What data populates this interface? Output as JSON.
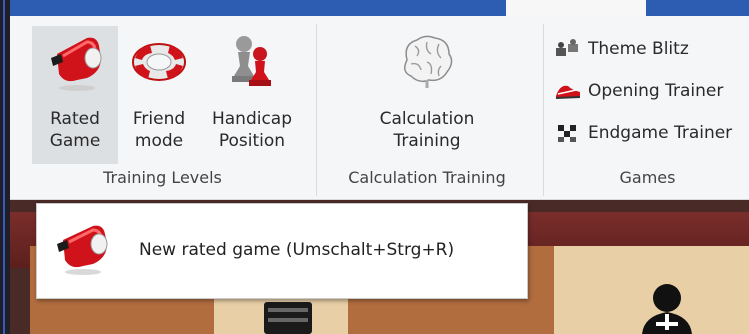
{
  "ribbon": {
    "groups": [
      {
        "label": "Training Levels",
        "buttons": [
          {
            "line1": "Rated",
            "line2": "Game",
            "icon": "whistle-icon",
            "selected": true
          },
          {
            "line1": "Friend",
            "line2": "mode",
            "icon": "lifebuoy-icon"
          },
          {
            "line1": "Handicap",
            "line2": "Position",
            "icon": "pawns-icon"
          }
        ]
      },
      {
        "label": "Calculation Training",
        "buttons": [
          {
            "line1": "Calculation",
            "line2": "Training",
            "icon": "brain-icon"
          }
        ]
      },
      {
        "label": "Games",
        "items": [
          {
            "label": "Theme Blitz",
            "icon": "theme-blitz-icon"
          },
          {
            "label": "Opening Trainer",
            "icon": "running-shoe-icon"
          },
          {
            "label": "Endgame Trainer",
            "icon": "endgame-icon"
          }
        ]
      }
    ]
  },
  "popup": {
    "item": {
      "label": "New rated game (Umschalt+Strg+R)",
      "icon": "whistle-icon"
    }
  },
  "colors": {
    "tabbar": "#2d5db3",
    "ribbon_bg": "#f5f6f7",
    "selected_bg": "#dde0e3",
    "whistle_red": "#d0121b"
  }
}
